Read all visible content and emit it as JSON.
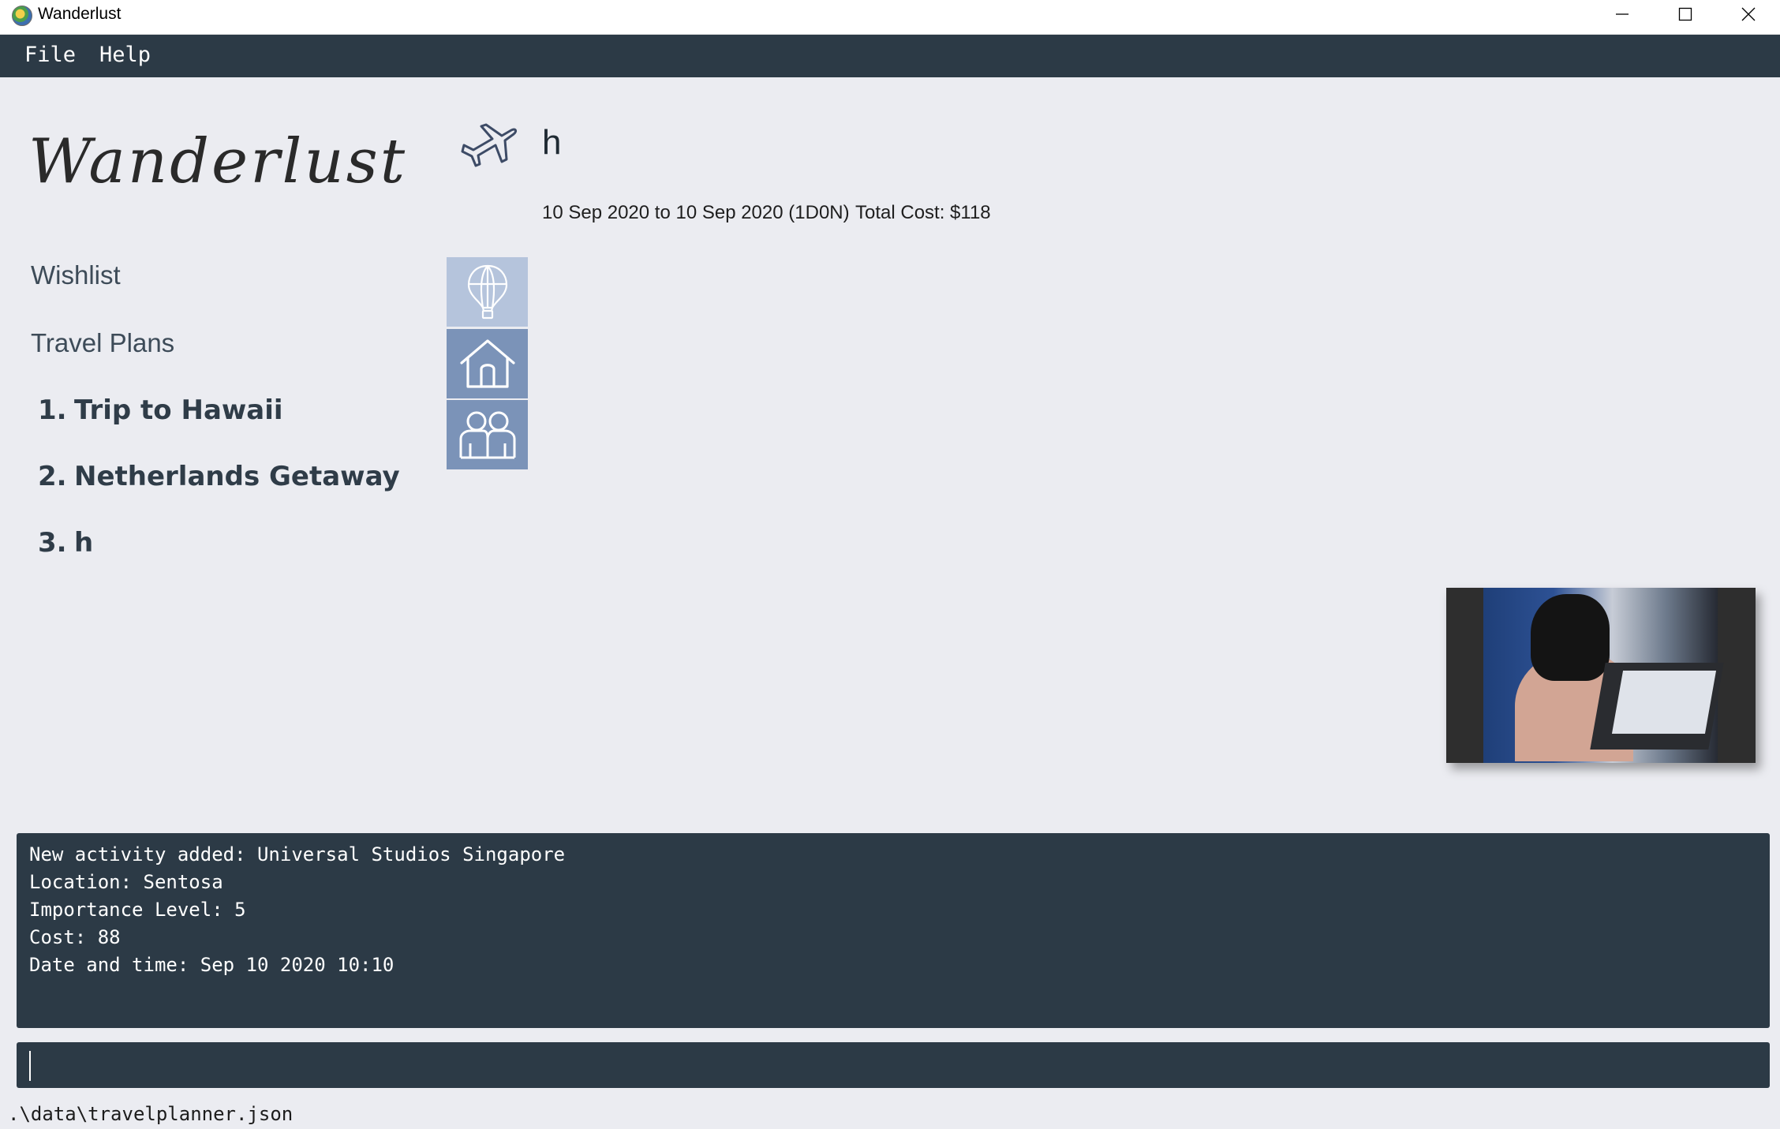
{
  "window": {
    "title": "Wanderlust",
    "icons": {
      "app": "globe-icon",
      "minimize": "minimize-icon",
      "maximize": "maximize-icon",
      "close": "close-icon"
    }
  },
  "menu": {
    "file": "File",
    "help": "Help"
  },
  "sidebar": {
    "logo_text": "Wanderlust",
    "wishlist": "Wishlist",
    "travel_plans": "Travel Plans",
    "plans": [
      {
        "number": "1.",
        "name": "Trip to Hawaii"
      },
      {
        "number": "2.",
        "name": "Netherlands Getaway"
      },
      {
        "number": "3.",
        "name": "h"
      }
    ]
  },
  "trip": {
    "icon": "airplane-icon",
    "name": "h",
    "dates": "10 Sep 2020 to 10 Sep 2020 (1D0N)",
    "total_cost": "Total Cost: $118"
  },
  "tabs": [
    {
      "name": "activity",
      "icon": "hot-air-balloon-icon",
      "selected": true
    },
    {
      "name": "accommodation",
      "icon": "house-icon",
      "selected": false
    },
    {
      "name": "friends",
      "icon": "people-icon",
      "selected": false
    }
  ],
  "result": {
    "lines": [
      "New activity added: Universal Studios Singapore",
      "Location: Sentosa",
      "Importance Level: 5",
      "Cost: 88",
      "Date and time: Sep 10 2020 10:10"
    ]
  },
  "command": {
    "value": ""
  },
  "status": {
    "file_path": ".\\data\\travelplanner.json"
  },
  "colors": {
    "background": "#ebecf1",
    "dark_panel": "#2c3a46",
    "tab_selected": "#b5c4dc",
    "tab_default": "#7b93b8"
  }
}
